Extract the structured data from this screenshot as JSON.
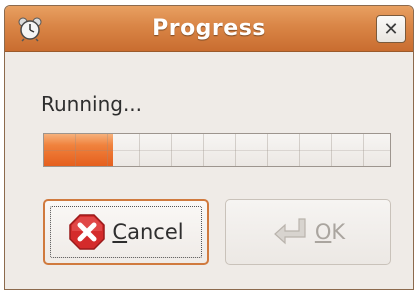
{
  "window": {
    "title": "Progress",
    "title_icon": "alarm-clock-icon",
    "close_icon": "close-icon",
    "close_glyph": "✕"
  },
  "status": {
    "text": "Running..."
  },
  "progress": {
    "fraction": 0.2,
    "segments": 11,
    "fill_color": "#f0823d"
  },
  "buttons": {
    "cancel": {
      "label_mnemonic": "C",
      "label_rest": "ancel",
      "icon": "cancel-stop-icon",
      "enabled": true
    },
    "ok": {
      "label_mnemonic": "O",
      "label_rest": "K",
      "icon": "enter-arrow-icon",
      "enabled": false
    }
  },
  "colors": {
    "titlebar": "#d98546",
    "window_bg": "#efebe7",
    "accent": "#d07a3e"
  }
}
